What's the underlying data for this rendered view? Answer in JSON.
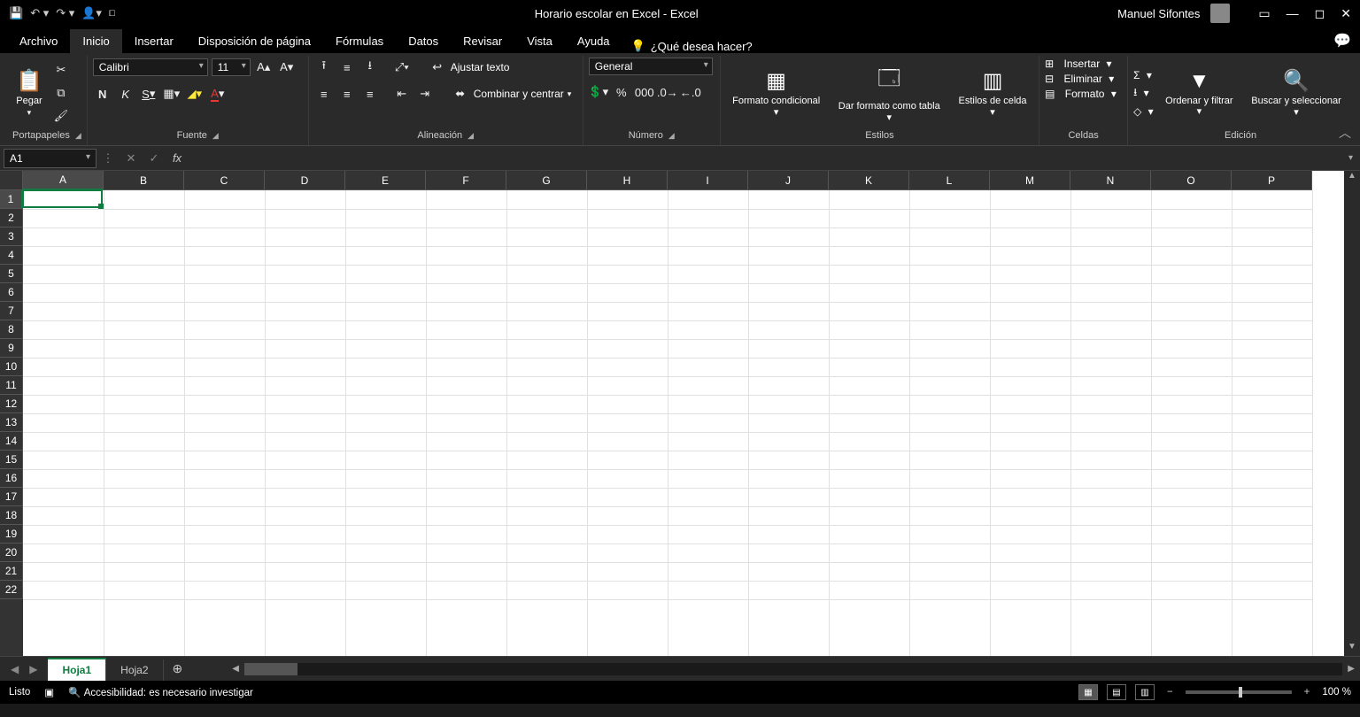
{
  "title_bar": {
    "document_title": "Horario escolar en Excel  -  Excel",
    "user_name": "Manuel Sifontes"
  },
  "tabs": {
    "items": [
      "Archivo",
      "Inicio",
      "Insertar",
      "Disposición de página",
      "Fórmulas",
      "Datos",
      "Revisar",
      "Vista",
      "Ayuda"
    ],
    "active_index": 1,
    "tell_me": "¿Qué desea hacer?"
  },
  "ribbon": {
    "clipboard": {
      "paste": "Pegar",
      "label": "Portapapeles"
    },
    "font": {
      "name": "Calibri",
      "size": "11",
      "bold": "N",
      "italic": "K",
      "underline": "S",
      "label": "Fuente"
    },
    "alignment": {
      "wrap": "Ajustar texto",
      "merge": "Combinar y centrar",
      "label": "Alineación"
    },
    "number": {
      "format": "General",
      "label": "Número"
    },
    "styles": {
      "cond_fmt": "Formato condicional",
      "as_table": "Dar formato como tabla",
      "cell_styles": "Estilos de celda",
      "label": "Estilos"
    },
    "cells": {
      "insert": "Insertar",
      "delete": "Eliminar",
      "format": "Formato",
      "label": "Celdas"
    },
    "editing": {
      "sort": "Ordenar y filtrar",
      "find": "Buscar y seleccionar",
      "label": "Edición"
    }
  },
  "formula_bar": {
    "name_box": "A1",
    "formula": ""
  },
  "grid": {
    "columns": [
      "A",
      "B",
      "C",
      "D",
      "E",
      "F",
      "G",
      "H",
      "I",
      "J",
      "K",
      "L",
      "M",
      "N",
      "O",
      "P"
    ],
    "rows": [
      1,
      2,
      3,
      4,
      5,
      6,
      7,
      8,
      9,
      10,
      11,
      12,
      13,
      14,
      15,
      16,
      17,
      18,
      19,
      20,
      21,
      22
    ],
    "selected_cell": "A1",
    "col_widths": {
      "default": 91
    }
  },
  "sheets": {
    "tabs": [
      "Hoja1",
      "Hoja2"
    ],
    "active_index": 0
  },
  "status_bar": {
    "ready": "Listo",
    "accessibility": "Accesibilidad: es necesario investigar",
    "zoom": "100 %"
  }
}
